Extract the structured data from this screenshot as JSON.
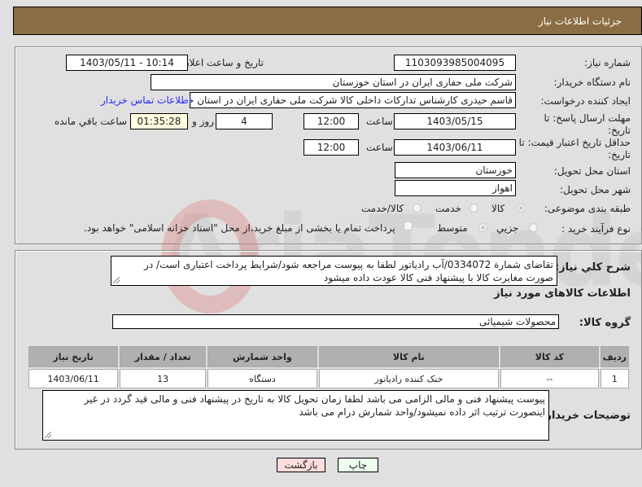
{
  "header": {
    "title": "جزئیات اطلاعات نیاز"
  },
  "form": {
    "need_number_label": "شماره نیاز:",
    "need_number": "1103093985004095",
    "announce_label": "تاریخ و ساعت اعلان عمومی:",
    "announce_value": "1403/05/11 - 10:14",
    "buyer_org_label": "نام دستگاه خریدار:",
    "buyer_org": "شرکت ملی حفاری ایران در استان خوزستان",
    "creator_label": "ایجاد کننده درخواست:",
    "creator": "قاسم حیدری کارشناس تدارکات داخلی کالا شرکت ملی حفاری ایران در استان خوزستان",
    "contact_link": "اطلاعات تماس خریدار",
    "deadline_label": "مهلت ارسال پاسخ: تا تاریخ:",
    "deadline_date": "1403/05/15",
    "time_label": "ساعت",
    "deadline_time": "12:00",
    "days_value": "4",
    "days_label": "روز و",
    "remaining_time": "01:35:28",
    "remaining_label": "ساعت باقي مانده",
    "price_validity_label": "حداقل تاریخ اعتبار قیمت: تا تاریخ:",
    "price_validity_date": "1403/06/11",
    "price_validity_time": "12:00",
    "province_label": "استان محل تحویل:",
    "province": "خوزستان",
    "city_label": "شهر محل تحویل:",
    "city": "اهواز",
    "category_label": "طبقه بندی موضوعی:",
    "category_options": [
      "کالا",
      "خدمت",
      "کالا/خدمت"
    ],
    "category_selected": "کالا",
    "process_label": "نوع فرآیند خرید :",
    "process_options": [
      "جزیي",
      "متوسط"
    ],
    "process_selected": "متوسط",
    "payment_checkbox_label": "پرداخت تمام یا بخشی از مبلغ خرید،از محل \"اسناد خزانه اسلامی\" خواهد بود.",
    "payment_checked": false
  },
  "description": {
    "label": "شرح کلي نیاز:",
    "text": "تقاضای شمارة 0334072/آب رادیاتور لطفا به پیوست مراجعه شود/شرایط پرداخت اعتباری است/ در صورت مغایرت کالا با پیشنهاد فنی کالا عودت داده میشود"
  },
  "goods": {
    "section_title": "اطلاعات کالاهای مورد نیاز",
    "group_label": "گروه کالا:",
    "group_value": "محصولات شیمیائی",
    "columns": [
      "ردیف",
      "کد کالا",
      "نام کالا",
      "واحد شمارش",
      "تعداد / مقدار",
      "تاریخ نیاز"
    ],
    "rows": [
      [
        "1",
        "--",
        "خنک کننده رادیاتور",
        "دستگاه",
        "13",
        "1403/06/11"
      ]
    ]
  },
  "buyer_notes": {
    "label": "توضیحات خریدار:",
    "text": "پیوست پیشنهاد فنی و مالی الزامی می باشد لطفا زمان تحویل کالا به تاریخ در پیشنهاد فنی و مالی قید گردد در غیر اینصورت ترتیب اثر داده نمیشود/واحد شمارش درام می باشد"
  },
  "buttons": {
    "print": "چاپ",
    "back": "بازگشت"
  },
  "watermark": "AriaTender.neT"
}
